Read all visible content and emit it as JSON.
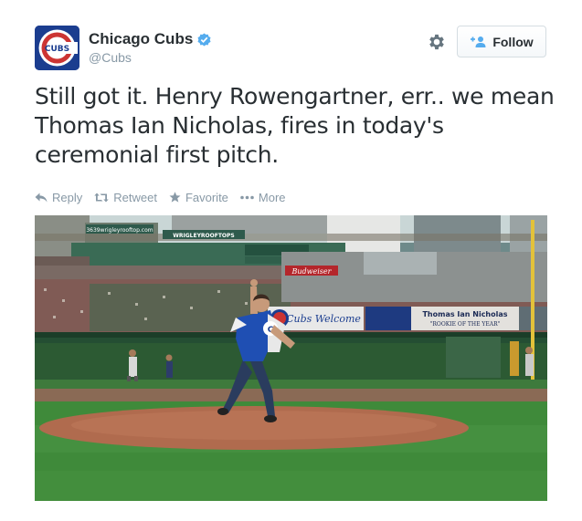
{
  "user": {
    "display_name": "Chicago Cubs",
    "screen_name": "@Cubs",
    "avatar_text": "CUBS",
    "verified": true
  },
  "follow": {
    "label": "Follow"
  },
  "tweet": {
    "text": "Still got it. Henry Rowengartner, err.. we mean Thomas Ian Nicholas, fires in today's ceremonial first pitch."
  },
  "actions": [
    {
      "label": "Reply",
      "icon": "reply-icon"
    },
    {
      "label": "Retweet",
      "icon": "retweet-icon"
    },
    {
      "label": "Favorite",
      "icon": "star-icon"
    },
    {
      "label": "More",
      "icon": "more-dots-icon"
    }
  ],
  "media": {
    "sign_url": "3639wrigleyrooftop.com",
    "sign_rooftops": "WRIGLEYROOFTOPS",
    "sign_budweiser": "Budweiser",
    "sign_welcome": "Cubs Welcome",
    "sign_name": "Thomas Ian Nicholas",
    "sign_rookie": "\"ROOKIE OF THE YEAR\""
  },
  "colors": {
    "link_blue": "#55acee",
    "muted": "#8899a6",
    "text": "#292f33",
    "cubs_blue": "#1b3d8f",
    "cubs_red": "#cc3433"
  }
}
